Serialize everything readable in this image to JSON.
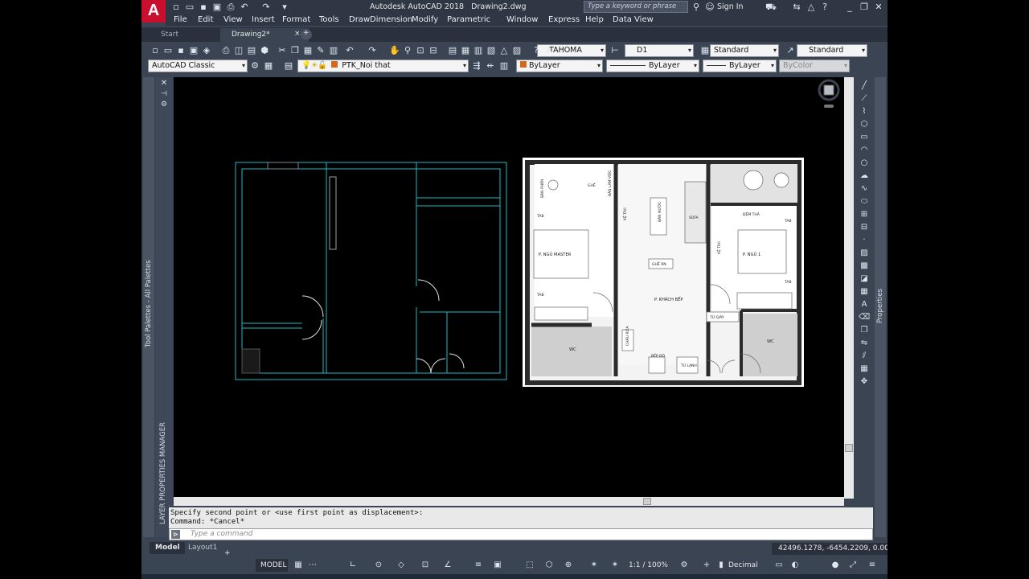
{
  "app": {
    "title": "Autodesk AutoCAD 2018",
    "file": "Drawing2.dwg",
    "logo_letter": "A",
    "search_placeholder": "Type a keyword or phrase",
    "sign_in": "Sign In"
  },
  "menu": [
    "File",
    "Edit",
    "View",
    "Insert",
    "Format",
    "Tools",
    "Draw",
    "Dimension",
    "Modify",
    "Parametric",
    "Window",
    "Express",
    "Help",
    "Data View"
  ],
  "tabs": {
    "start": "Start",
    "drawing": "Drawing2*",
    "close": "×",
    "new": "+"
  },
  "toolbar": {
    "text_style_font": "TAHOMA",
    "dim_style": "D1",
    "table_style": "Standard",
    "multileader_style": "Standard",
    "workspace": "AutoCAD Classic",
    "layer": "PTK_Noi that",
    "color": "ByLayer",
    "linetype": "ByLayer",
    "lineweight": "ByLayer",
    "plotstyle": "ByColor"
  },
  "palettes": {
    "tool_palettes": "Tool Palettes - All Palettes",
    "layer_manager": "LAYER PROPERTIES MANAGER",
    "properties": "Properties"
  },
  "command": {
    "history_line1": "Specify second point or <use first point as displacement>:",
    "history_line2": "Command: *Cancel*",
    "input_placeholder": "Type a command"
  },
  "layout_tabs": {
    "model": "Model",
    "layout1": "Layout1",
    "add": "+"
  },
  "status": {
    "coordinates": "42496.1278, -6454.2209, 0.0000",
    "space": "MODEL",
    "scale": "1:1 / 100%",
    "units": "Decimal"
  },
  "floorplan": {
    "rooms": {
      "master": "P. NGỦ MASTER",
      "bed1": "P. NGỦ 1",
      "living": "P. KHÁCH BẾP",
      "wc1": "WC",
      "wc2": "WC",
      "sofa": "SOFA",
      "dining": "GHẾ ĂN",
      "water": "BÀN NƯỚC",
      "tv1": "KỆ TIVI",
      "tv2": "KỆ TIVI",
      "desk": "BÀN LÀM VIỆC",
      "chair": "GHẾ",
      "vanity": "BÀN PHẤN",
      "tab1": "TAB",
      "tab2": "TAB",
      "tab3": "TAB",
      "tab4": "TAB",
      "shoes": "TỦ GIÀY",
      "fridge": "TỦ LẠNH",
      "sink": "CHẬU RỬA",
      "stove": "BẾP ĐỘ",
      "window_seat": "ĐỆM THẢ"
    }
  }
}
